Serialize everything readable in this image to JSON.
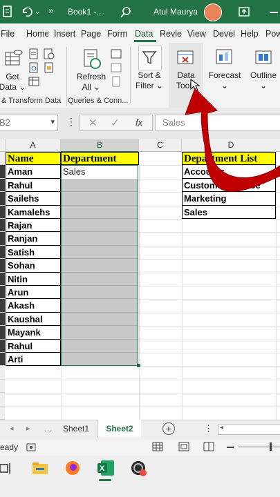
{
  "titlebar": {
    "book_title": "Book1 -...",
    "user_name": "Atul Maurya",
    "more_label": "»"
  },
  "ribbon_tabs": [
    "File",
    "Home",
    "Insert",
    "Page",
    "Form",
    "Data",
    "Revie",
    "View",
    "Devel",
    "Help",
    "Pow"
  ],
  "ribbon": {
    "get_data": "Get\nData ⌄",
    "refresh_all": "Refresh\nAll ⌄",
    "sort_filter": "Sort &\nFilter ⌄",
    "data_tools": "Data\nTools",
    "forecast": "Forecast\n⌄",
    "outline": "Outline\n⌄",
    "group_transform": "& Transform Data",
    "group_queries": "Queries & Conn...",
    "group_connector": "|"
  },
  "formula_bar": {
    "name_box": "B2",
    "fx": "fx",
    "formula": "Sales"
  },
  "grid": {
    "columns": [
      "A",
      "B",
      "C",
      "D"
    ],
    "header_name": "Name",
    "header_department": "Department",
    "header_department_list": "Department List",
    "names": [
      "Aman",
      "Rahul",
      "Sailehs",
      "Kamalehs",
      "Rajan",
      "Ranjan",
      "Satish",
      "Sohan",
      "Nitin",
      "Arun",
      "Akash",
      "Kaushal",
      "Mayank",
      "Rahul",
      "Arti"
    ],
    "department_value": "Sales",
    "department_list": [
      "Accounts",
      "Customer Service",
      "Marketing",
      "Sales"
    ]
  },
  "sheets": [
    "Sheet1",
    "Sheet2"
  ],
  "status": {
    "ready": "eady"
  },
  "colors": {
    "excel_green": "#217346",
    "header_yellow": "#ffff00",
    "selection_gray": "#c8c8c8",
    "arrow_red": "#c00000"
  }
}
